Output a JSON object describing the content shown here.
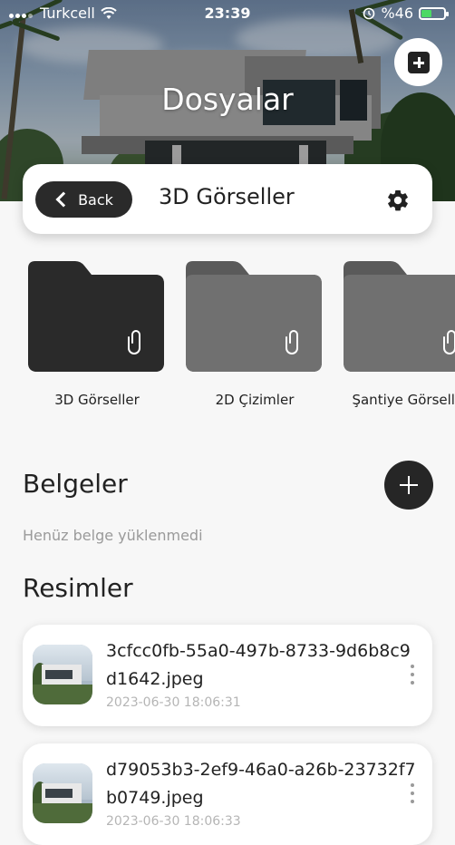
{
  "status_bar": {
    "carrier": "Turkcell",
    "time": "23:39",
    "battery": "%46",
    "battery_level": 0.46,
    "icons": [
      "signal-icon",
      "wifi-icon",
      "alarm-icon",
      "battery-icon"
    ]
  },
  "hero": {
    "title": "Dosyalar",
    "add_icon": "plus-square-icon"
  },
  "header": {
    "back_label": "Back",
    "title": "3D Görseller",
    "settings_icon": "gear-icon"
  },
  "folders": [
    {
      "label": "3D Görseller",
      "color": "#2a2a2a",
      "selected": true
    },
    {
      "label": "2D Çizimler",
      "color": "#6f6f6f",
      "selected": false
    },
    {
      "label": "Şantiye Görselleri",
      "color": "#6f6f6f",
      "selected": false
    }
  ],
  "documents": {
    "title": "Belgeler",
    "empty_text": "Henüz belge yüklenmedi",
    "add_icon": "plus-icon"
  },
  "images": {
    "title": "Resimler",
    "items": [
      {
        "name": "3cfcc0fb-55a0-497b-8733-9d6b8c9d1642.jpeg",
        "date": "2023-06-30 18:06:31"
      },
      {
        "name": "d79053b3-2ef9-46a0-a26b-23732f7b0749.jpeg",
        "date": "2023-06-30 18:06:33"
      }
    ]
  }
}
